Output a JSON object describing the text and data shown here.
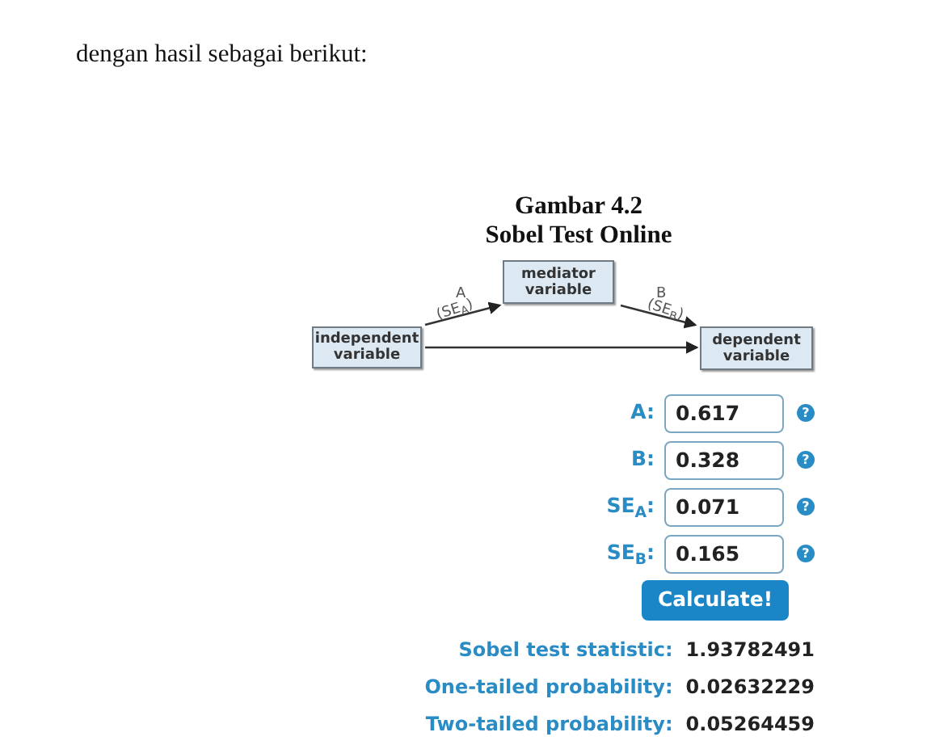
{
  "document": {
    "paragraph": "dengan hasil sebagai berikut:",
    "figure_number": "Gambar 4.2",
    "figure_title": "Sobel Test Online"
  },
  "diagram": {
    "nodes": [
      {
        "label": "independent variable"
      },
      {
        "label": "mediator variable"
      },
      {
        "label": "dependent variable"
      }
    ],
    "paths": [
      {
        "label": "A",
        "se": "(SE$_{A}$)"
      },
      {
        "label": "B",
        "se": "(SE$_{B}$)"
      }
    ]
  },
  "inputs": [
    {
      "label": "A:",
      "value": "0.617",
      "help": "?"
    },
    {
      "label": "B:",
      "value": "0.328",
      "help": "?"
    },
    {
      "label": "SE$_{A}$:",
      "value": "0.071",
      "help": "?"
    },
    {
      "label": "SE$_{B}$:",
      "value": "0.165",
      "help": "?"
    }
  ],
  "button": "Calculate!",
  "results": [
    {
      "label": "Sobel test statistic:",
      "value": "1.93782491"
    },
    {
      "label": "One-tailed probability:",
      "value": "0.02632229"
    },
    {
      "label": "Two-tailed probability:",
      "value": "0.05264459"
    }
  ]
}
